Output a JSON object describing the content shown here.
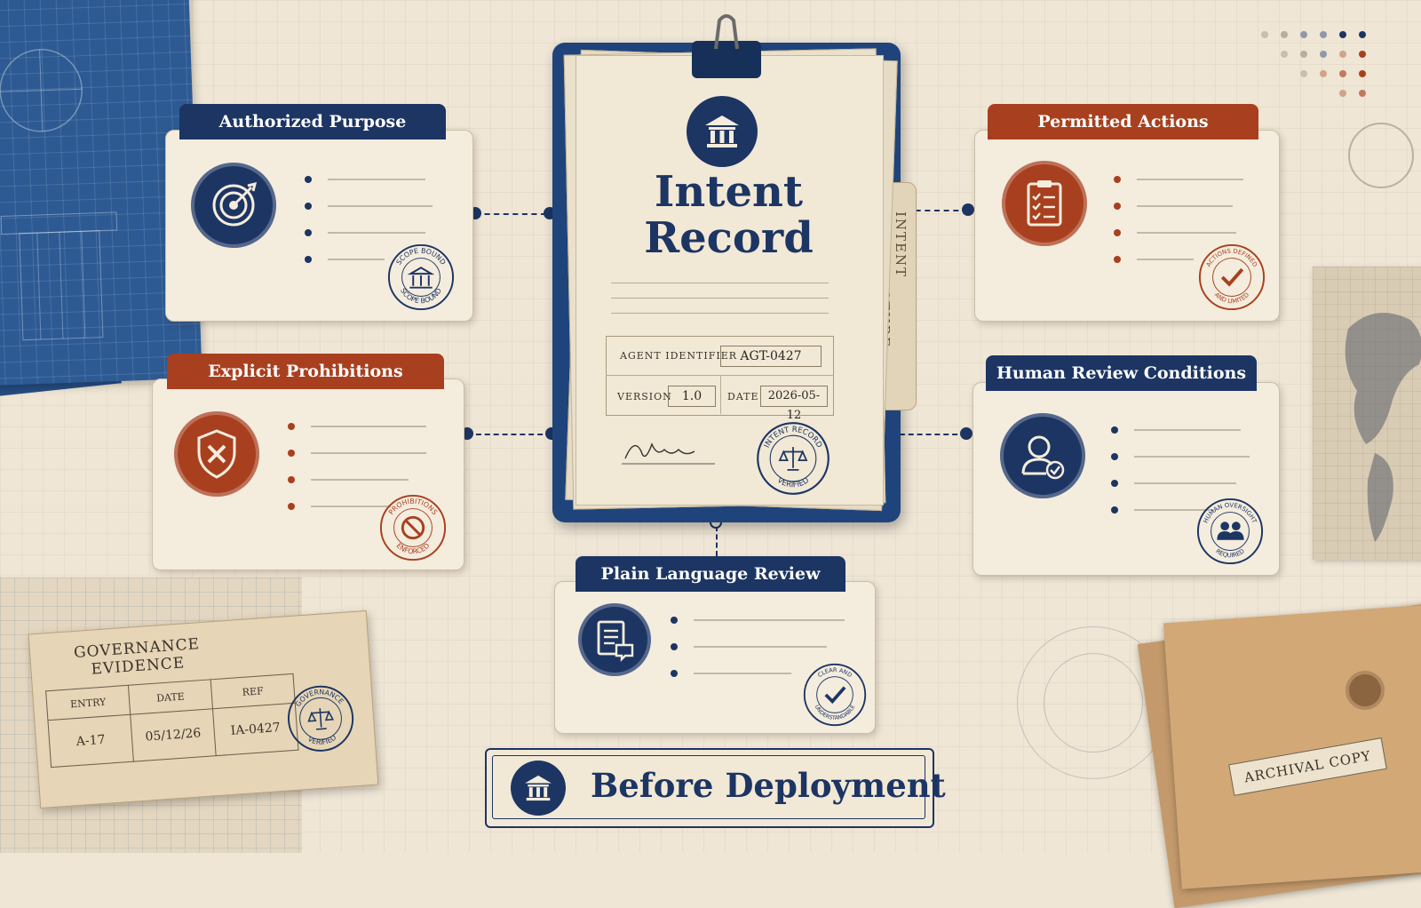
{
  "center": {
    "title_line1": "Intent",
    "title_line2": "Record",
    "side_tab": "INTENT ARCHITECTURE",
    "agent_label": "AGENT IDENTIFIER",
    "agent_value": "AGT-0427",
    "version_label": "VERSION",
    "version_value": "1.0",
    "date_label": "DATE",
    "date_value": "2026-05-12",
    "stamp_top": "INTENT RECORD",
    "stamp_bottom": "VERIFIED"
  },
  "cards": {
    "authorized": {
      "title": "Authorized Purpose",
      "icon": "target-icon",
      "stamp_top": "SCOPE BOUND",
      "stamp_bottom": "SCOPE BOUND"
    },
    "permitted": {
      "title": "Permitted Actions",
      "icon": "clipboard-checklist-icon",
      "stamp_top": "ACTIONS DEFINED",
      "stamp_bottom": "AND LIMITED"
    },
    "prohibitions": {
      "title": "Explicit Prohibitions",
      "icon": "shield-x-icon",
      "stamp_top": "PROHIBITIONS",
      "stamp_bottom": "ENFORCED"
    },
    "human_review": {
      "title": "Human Review Conditions",
      "icon": "user-check-icon",
      "stamp_top": "HUMAN OVERSIGHT",
      "stamp_bottom": "REQUIRED"
    },
    "plain_language": {
      "title": "Plain Language Review",
      "icon": "document-chat-icon",
      "stamp_top": "CLEAR AND",
      "stamp_bottom": "UNDERSTANDABLE"
    }
  },
  "evidence": {
    "title_line1": "GOVERNANCE",
    "title_line2": "EVIDENCE",
    "headers": [
      "ENTRY",
      "DATE",
      "REF"
    ],
    "row": [
      "A-17",
      "05/12/26",
      "IA-0427"
    ],
    "stamp_top": "GOVERNANCE",
    "stamp_bottom": "VERIFIED"
  },
  "archival": "ARCHIVAL COPY",
  "footer": {
    "label": "Before Deployment"
  },
  "colors": {
    "navy": "#1c3563",
    "rust": "#a8401f",
    "paper": "#f4ecdd"
  }
}
